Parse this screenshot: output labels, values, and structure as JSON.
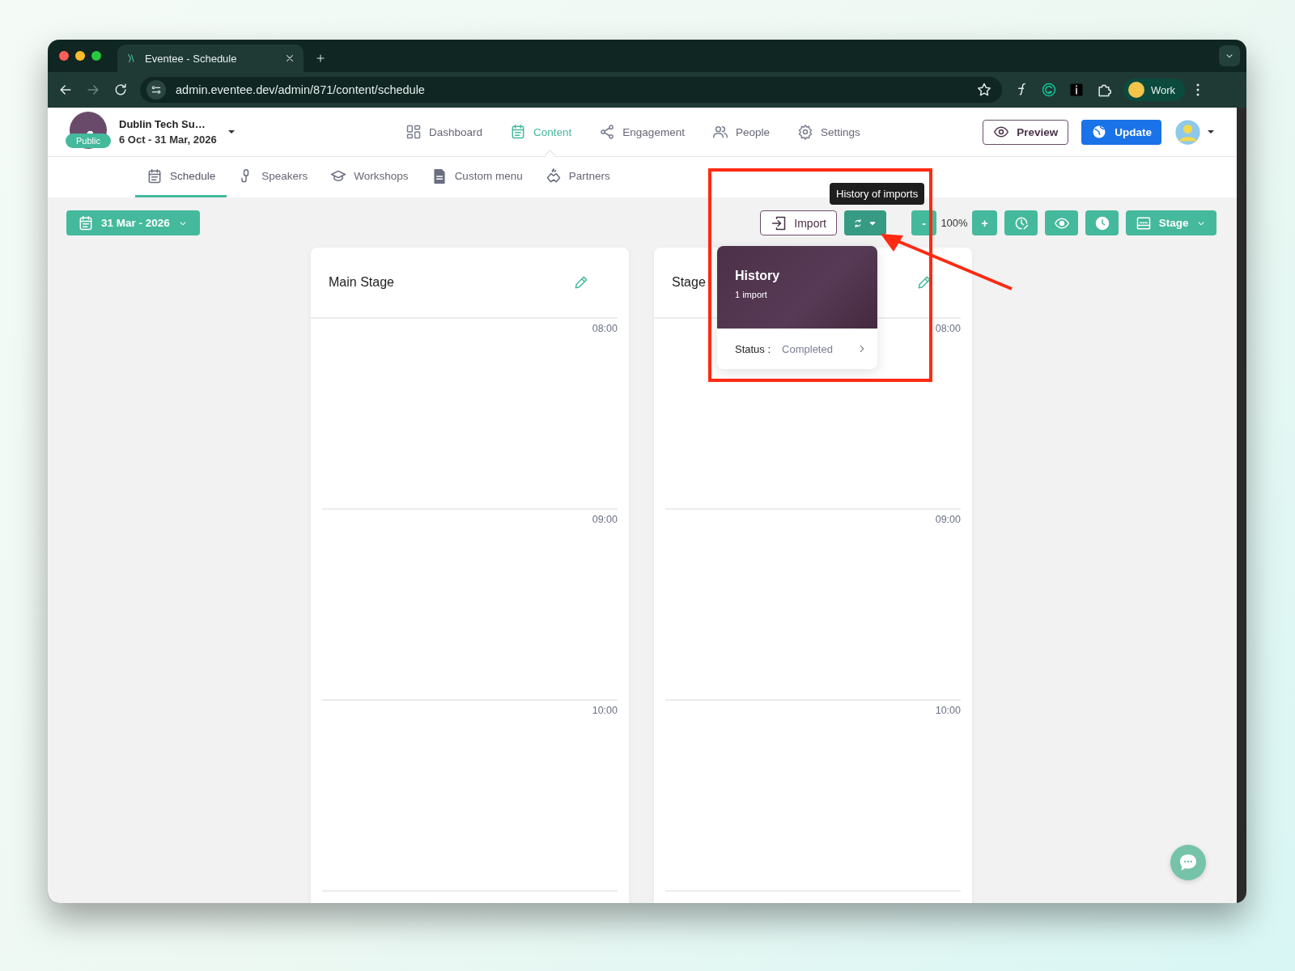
{
  "browser": {
    "tab_title": "Eventee - Schedule",
    "url": "admin.eventee.dev/admin/871/content/schedule",
    "profile": "Work"
  },
  "header": {
    "event_name": "Dublin Tech Su…",
    "dates": "6 Oct - 31 Mar, 2026",
    "badge": "Public",
    "nav": [
      {
        "label": "Dashboard",
        "selected": false
      },
      {
        "label": "Content",
        "selected": true
      },
      {
        "label": "Engagement",
        "selected": false
      },
      {
        "label": "People",
        "selected": false
      },
      {
        "label": "Settings",
        "selected": false
      }
    ],
    "preview": "Preview",
    "update": "Update"
  },
  "subnav": [
    {
      "label": "Schedule",
      "selected": true
    },
    {
      "label": "Speakers",
      "selected": false
    },
    {
      "label": "Workshops",
      "selected": false
    },
    {
      "label": "Custom menu",
      "selected": false
    },
    {
      "label": "Partners",
      "selected": false
    }
  ],
  "toolbar": {
    "date": "31 Mar - 2026",
    "import": "Import",
    "tooltip": "History of imports",
    "zoom_out": "-",
    "zoom": "100%",
    "zoom_in": "+",
    "view": "Stage"
  },
  "stages": [
    {
      "name": "Main Stage",
      "hours": [
        "08:00",
        "09:00",
        "10:00"
      ]
    },
    {
      "name": "Stage",
      "hours": [
        "08:00",
        "09:00",
        "10:00"
      ]
    }
  ],
  "history_popup": {
    "title": "History",
    "count": "1 import",
    "status_label": "Status :",
    "status": "Completed"
  }
}
